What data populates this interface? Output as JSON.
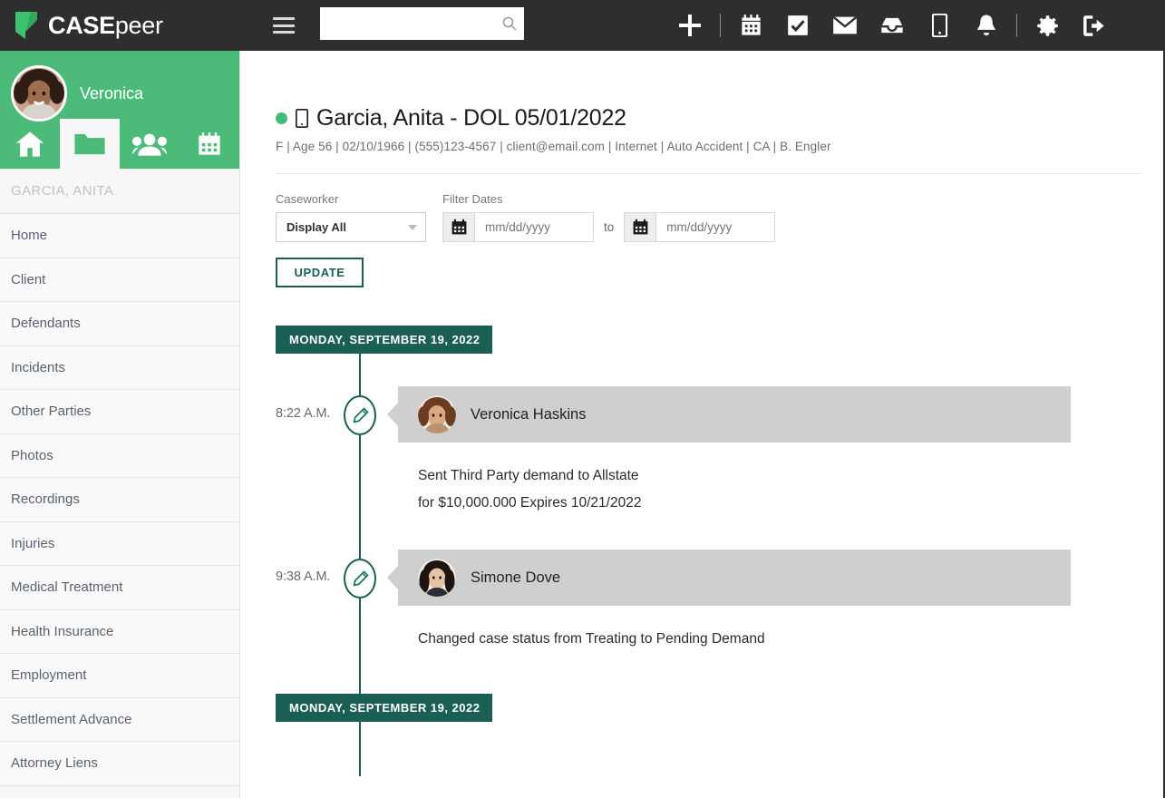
{
  "brand": {
    "name_bold": "CASE",
    "name_thin": "peer"
  },
  "topbar": {
    "search_value": "",
    "search_placeholder": "",
    "icons": [
      {
        "name": "add-icon",
        "label": "Add"
      },
      {
        "name": "calendar-icon",
        "label": "Calendar"
      },
      {
        "name": "tasks-icon",
        "label": "Tasks"
      },
      {
        "name": "email-icon",
        "label": "Email"
      },
      {
        "name": "inbox-icon",
        "label": "Inbox"
      },
      {
        "name": "mobile-icon",
        "label": "Mobile"
      },
      {
        "name": "notifications-icon",
        "label": "Notifications"
      },
      {
        "name": "settings-icon",
        "label": "Settings"
      },
      {
        "name": "logout-icon",
        "label": "Log out"
      }
    ]
  },
  "sidebar": {
    "user_name": "Veronica",
    "case_name": "GARCIA, ANITA",
    "tabs": [
      {
        "icon": "home-icon",
        "label": "Home",
        "active": false
      },
      {
        "icon": "folder-icon",
        "label": "Cases",
        "active": true
      },
      {
        "icon": "people-icon",
        "label": "Contacts",
        "active": false
      },
      {
        "icon": "calendar-icon",
        "label": "Calendar",
        "active": false
      }
    ],
    "items": [
      {
        "label": "Home"
      },
      {
        "label": "Client"
      },
      {
        "label": "Defendants"
      },
      {
        "label": "Incidents"
      },
      {
        "label": "Other Parties"
      },
      {
        "label": "Photos"
      },
      {
        "label": "Recordings"
      },
      {
        "label": "Injuries"
      },
      {
        "label": "Medical Treatment"
      },
      {
        "label": "Health Insurance"
      },
      {
        "label": "Employment"
      },
      {
        "label": "Settlement Advance"
      },
      {
        "label": "Attorney Liens"
      }
    ]
  },
  "case_header": {
    "title": "Garcia, Anita - DOL 05/01/2022",
    "meta": "F | Age 56 | 02/10/1966 | (555)123-4567 | client@email.com | Internet | Auto Accident | CA | B. Engler",
    "status_color": "#45b97c"
  },
  "filters": {
    "caseworker_label": "Caseworker",
    "caseworker_value": "Display All",
    "filter_dates_label": "Filter Dates",
    "date_from_value": "",
    "date_from_placeholder": "mm/dd/yyyy",
    "date_to_value": "",
    "date_to_placeholder": "mm/dd/yyyy",
    "to_label": "to",
    "update_label": "UPDATE"
  },
  "timeline": {
    "accent_color": "#1a5e54",
    "groups": [
      {
        "date": "MONDAY, SEPTEMBER 19, 2022",
        "entries": [
          {
            "time": "8:22 A.M.",
            "author": "Veronica Haskins",
            "icon": "pencil-icon",
            "body_lines": [
              "Sent Third Party demand to Allstate",
              "for $10,000.000 Expires 10/21/2022"
            ]
          },
          {
            "time": "9:38 A.M.",
            "author": "Simone Dove",
            "icon": "pencil-icon",
            "body_lines": [
              "Changed case status from Treating to Pending Demand"
            ]
          }
        ]
      },
      {
        "date": "MONDAY, SEPTEMBER 19, 2022",
        "entries": []
      }
    ]
  }
}
